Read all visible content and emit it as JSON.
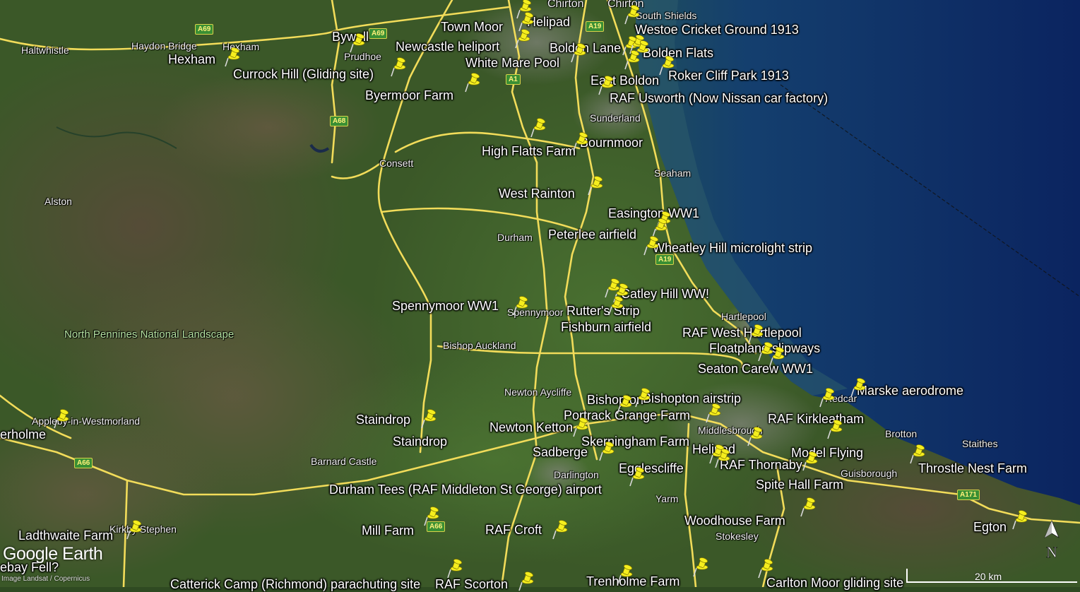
{
  "app": {
    "brand": "Google Earth",
    "credit": "Image Landsat / Copernicus",
    "scale_label": "20 km",
    "north_label": "N"
  },
  "places": {
    "haltwhistle": "Haltwhistle",
    "haydon_bridge": "Haydon Bridge",
    "hexham_town": "Hexham",
    "prudhoe": "Prudhoe",
    "chirton_a": "Chirton",
    "chirton_b": "Chirton",
    "south_shields": "South Shields",
    "sunderland": "Sunderland",
    "seaham": "Seaham",
    "consett": "Consett",
    "alston": "Alston",
    "durham": "Durham",
    "spennymoor": "Spennymoor",
    "hartlepool": "Hartlepool",
    "bishop_auckland": "Bishop Auckland",
    "national_landscape": "North Pennines National Landscape",
    "newton_aycliffe": "Newton Aycliffe",
    "redcar": "Redcar",
    "middlesbrough": "Middlesbrough",
    "brotton": "Brotton",
    "staithes": "Staithes",
    "appleby": "Appleby-in-Westmorland",
    "barnard_castle": "Barnard Castle",
    "darlington": "Darlington",
    "guisborough": "Guisborough",
    "yarm": "Yarm",
    "kirkby_stephen": "Kirkby Stephen",
    "stokesley": "Stokesley"
  },
  "roads": [
    "A69",
    "A69",
    "A1",
    "A19",
    "A68",
    "A19",
    "A66",
    "A171",
    "A66"
  ],
  "pins": {
    "helipad_north": "Helipad",
    "town_moor": "Town Moor",
    "westoe": "Westoe Cricket Ground 1913",
    "bywell": "Bywell",
    "newcastle_heliport": "Newcastle heliport",
    "boldon_lane": "Boldon Lane",
    "bolden_flats": "Bolden Flats",
    "hexham": "Hexham",
    "white_mare_pool": "White Mare Pool",
    "currock_hill": "Currock Hill (Gliding site)",
    "roker_cliff": "Roker Cliff Park 1913",
    "east_boldon": "East Boldon",
    "byermoor": "Byermoor Farm",
    "raf_usworth": "RAF Usworth  (Now Nissan car factory)",
    "bournmoor": "Bournmoor",
    "high_flatts": "High Flatts Farm",
    "west_rainton": "West Rainton",
    "easington": "Easington WW1",
    "peterlee": "Peterlee airfield",
    "wheatley_hill": "Wheatley Hill microlight strip",
    "catley_hill": "Catley Hill WW!",
    "spennymoor_ww1": "Spennymoor WW1",
    "rutters_strip": "Rutter's Strip",
    "fishburn": "Fishburn airfield",
    "raf_west_hartlepool": "RAF West Hartlepool",
    "floatplane": "Floatplane slipways",
    "seaton_carew": "Seaton Carew WW1",
    "marske": "Marske aerodrome",
    "bishopton": "Bishopton",
    "bishopton_airstrip": "Bishopton airstrip",
    "portrack": "Portrack Grange Farm",
    "raf_kirkleatham": "RAF Kirkleatham",
    "staindrop_a": "Staindrop",
    "newton_ketton": "Newton Ketton",
    "staindrop_b": "Staindrop",
    "skerningham": "Skerningham Farm",
    "model_flying": "Model Flying",
    "helipad_south": "Helipad",
    "sadberge": "Sadberge",
    "throstle_nest": "Throstle Nest Farm",
    "egglescliffe": "Egglescliffe",
    "raf_thornaby": "RAF Thornaby",
    "spite_hall": "Spite Hall Farm",
    "durham_tees": "Durham Tees (RAF Middleton St George) airport",
    "woodhouse": "Woodhouse Farm",
    "egton": "Egton",
    "raf_croft": "RAF Croft",
    "mill_farm": "Mill Farm",
    "ladthwaite": "Ladthwaite Farm",
    "erholme": "erholme",
    "stebay_fell": "ebay Fell?",
    "catterick": "Catterick Camp (Richmond) parachuting site",
    "raf_scorton": "RAF Scorton",
    "trenholme": "Trenholme Farm",
    "carlton_moor": "Carlton Moor gliding site"
  },
  "colors": {
    "land_green": "#3d5a2a",
    "sea": "#0d2a63",
    "coast_sea": "#1e4a66",
    "road": "#f2dc5a",
    "pin": "#f5ee1e"
  }
}
